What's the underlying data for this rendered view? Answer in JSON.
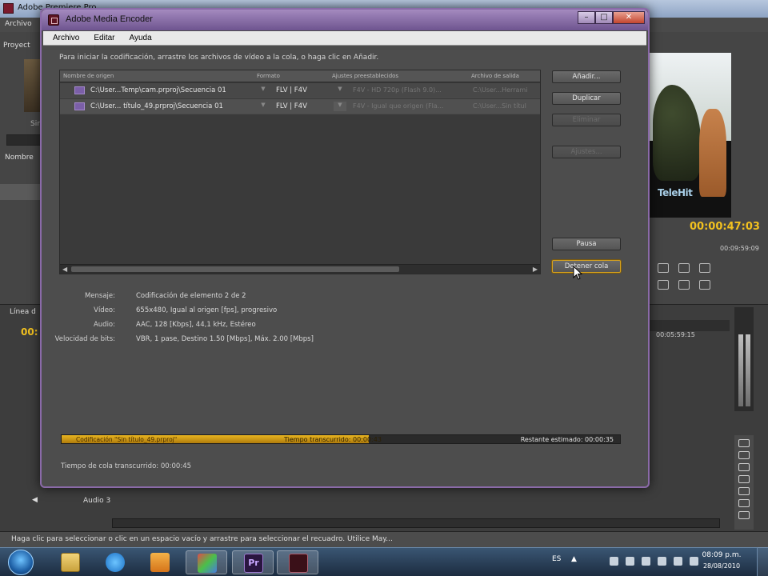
{
  "premiere": {
    "title": "Adobe Premiere Pro",
    "menu_first": "Archivo",
    "project_tab": "Proyect",
    "sin_label": "Sin",
    "nombre_header": "Nombre",
    "timeline_tab": "Línea d",
    "timeline_time": "00:",
    "timecode_main": "00:00:47:03",
    "timecode_duration": "00:09:59:09",
    "timeline_right_tc": "00:05:59:15",
    "audio_track": "Audio 3",
    "status_text": "Haga clic para seleccionar o clic en un espacio vacío y arrastre para seleccionar el recuadro. Utilice May...",
    "monitor_logo": "TeleHit"
  },
  "ame": {
    "title": "Adobe Media Encoder",
    "menu": [
      "Archivo",
      "Editar",
      "Ayuda"
    ],
    "instructions": "Para iniciar la codificación, arrastre los archivos de vídeo a la cola, o haga clic en Añadir.",
    "queue_headers": {
      "source": "Nombre de origen",
      "format": "Formato",
      "presets": "Ajustes preestablecidos",
      "output": "Archivo de salida"
    },
    "queue_rows": [
      {
        "source": "C:\\User...Temp\\cam.prproj\\Secuencia 01",
        "format": "FLV | F4V",
        "preset": "F4V - HD 720p (Flash 9.0)...",
        "output": "C:\\User...Herrami"
      },
      {
        "source": "C:\\User... título_49.prproj\\Secuencia 01",
        "format": "FLV | F4V",
        "preset": "F4V - Igual que origen (Fla...",
        "output": "C:\\User...Sin títul"
      }
    ],
    "buttons": {
      "add": "Añadir...",
      "duplicate": "Duplicar",
      "remove": "Eliminar",
      "settings": "Ajustes...",
      "pause": "Pausa",
      "stop_queue": "Detener cola"
    },
    "info": {
      "message_key": "Mensaje:",
      "message_val": "Codificación de elemento 2 de 2",
      "video_key": "Vídeo:",
      "video_val": "655x480, Igual al origen [fps], progresivo",
      "audio_key": "Audio:",
      "audio_val": "AAC, 128 [Kbps], 44,1 kHz, Estéreo",
      "bitrate_key": "Velocidad de bits:",
      "bitrate_val": "VBR, 1 pase, Destino 1.50 [Mbps], Máx. 2.00 [Mbps]"
    },
    "progress": {
      "label": "Codificación \"Sin título_49.prproj\"",
      "elapsed": "Tiempo transcurrido: 00:00:43",
      "remaining": "Restante estimado: 00:00:35",
      "fraction": 0.55
    },
    "queue_elapsed": "Tiempo de cola transcurrido:  00:00:45"
  },
  "taskbar": {
    "pr_label": "Pr",
    "lang": "ES",
    "time": "08:09 p.m.",
    "date": "28/08/2010"
  },
  "colors": {
    "accent_gold": "#f2c11f",
    "window_frame": "#8a6aa8"
  }
}
